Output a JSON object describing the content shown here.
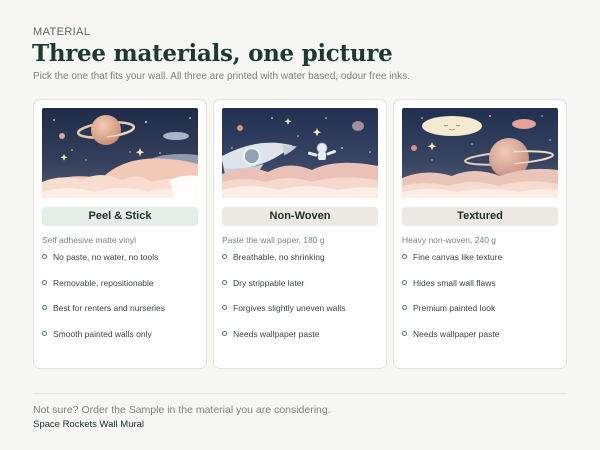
{
  "eyebrow": "MATERIAL",
  "title": "Three materials, one picture",
  "subtitle": "Pick the one that fits your wall. All three are printed with water based, odour free inks.",
  "cards": [
    {
      "name": "Peel & Stick",
      "spec": "Self adhesive matte vinyl",
      "features": [
        "No paste, no water, no tools",
        "Removable, repositionable",
        "Best for renters and nurseries",
        "Smooth painted walls only"
      ]
    },
    {
      "name": "Non-Woven",
      "spec": "Paste the wall paper, 180 g",
      "features": [
        "Breathable, no shrinking",
        "Dry strippable later",
        "Forgives slightly uneven walls",
        "Needs wallpaper paste"
      ]
    },
    {
      "name": "Textured",
      "spec": "Heavy non-woven, 240 g",
      "features": [
        "Fine canvas like texture",
        "Hides small wall flaws",
        "Premium painted look",
        "Needs wallpaper paste"
      ]
    }
  ],
  "footer": {
    "note": "Not sure? Order the Sample in the material you are considering.",
    "product": "Space Rockets Wall Mural"
  },
  "colors": {
    "page_bg": "#f6f6f3",
    "title": "#1e3a2f",
    "pill_selected": "#e6ece8",
    "pill_default": "#ece8e4",
    "bullet": "#4f7a66"
  }
}
